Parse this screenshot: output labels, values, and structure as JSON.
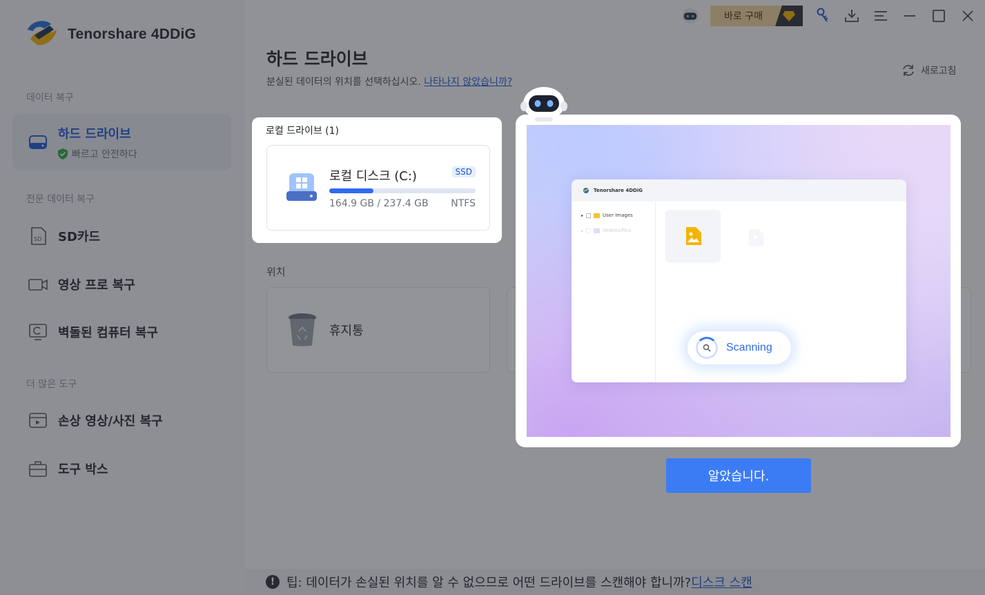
{
  "app": {
    "name": "Tenorshare 4DDiG"
  },
  "titlebar": {
    "buy_label": "바로 구매"
  },
  "sidebar": {
    "section_recovery": "데이터 복구",
    "hard_drive": {
      "label": "하드 드라이브",
      "sub": "빠르고 안전하다"
    },
    "section_pro": "전문 데이터 복구",
    "sd_card": "SD카드",
    "video_pro": "영상 프로 복구",
    "crashed_pc": "벽돌된 컴퓨터 복구",
    "section_more": "더 많은 도구",
    "damaged_media": "손상 영상/사진 복구",
    "toolbox": "도구 박스"
  },
  "main": {
    "title": "하드 드라이브",
    "desc": "분실된 데이터의 위치를 선택하십시오.",
    "desc_link": "나타나지 않았습니까?",
    "refresh": "새로고침",
    "local_drives_label": "로컬 드라이브 (1)",
    "drive": {
      "name": "로컬 디스크 (C:)",
      "type": "SSD",
      "size": "164.9 GB / 237.4 GB",
      "fs": "NTFS",
      "usage": 0.3
    },
    "location_label": "위치",
    "recycle_bin": "휴지통"
  },
  "tip": {
    "text": "팁: 데이터가 손실된 위치를 알 수 없으므로 어떤 드라이브를 스캔해야 합니까?",
    "link": "디스크 스캔"
  },
  "guide": {
    "mock_app": "Tenorshare 4DDiG",
    "mock_folder1": "User Images",
    "mock_folder2": "Vedeos/Pics",
    "scanning": "Scanning",
    "ok_button": "알았습니다."
  }
}
